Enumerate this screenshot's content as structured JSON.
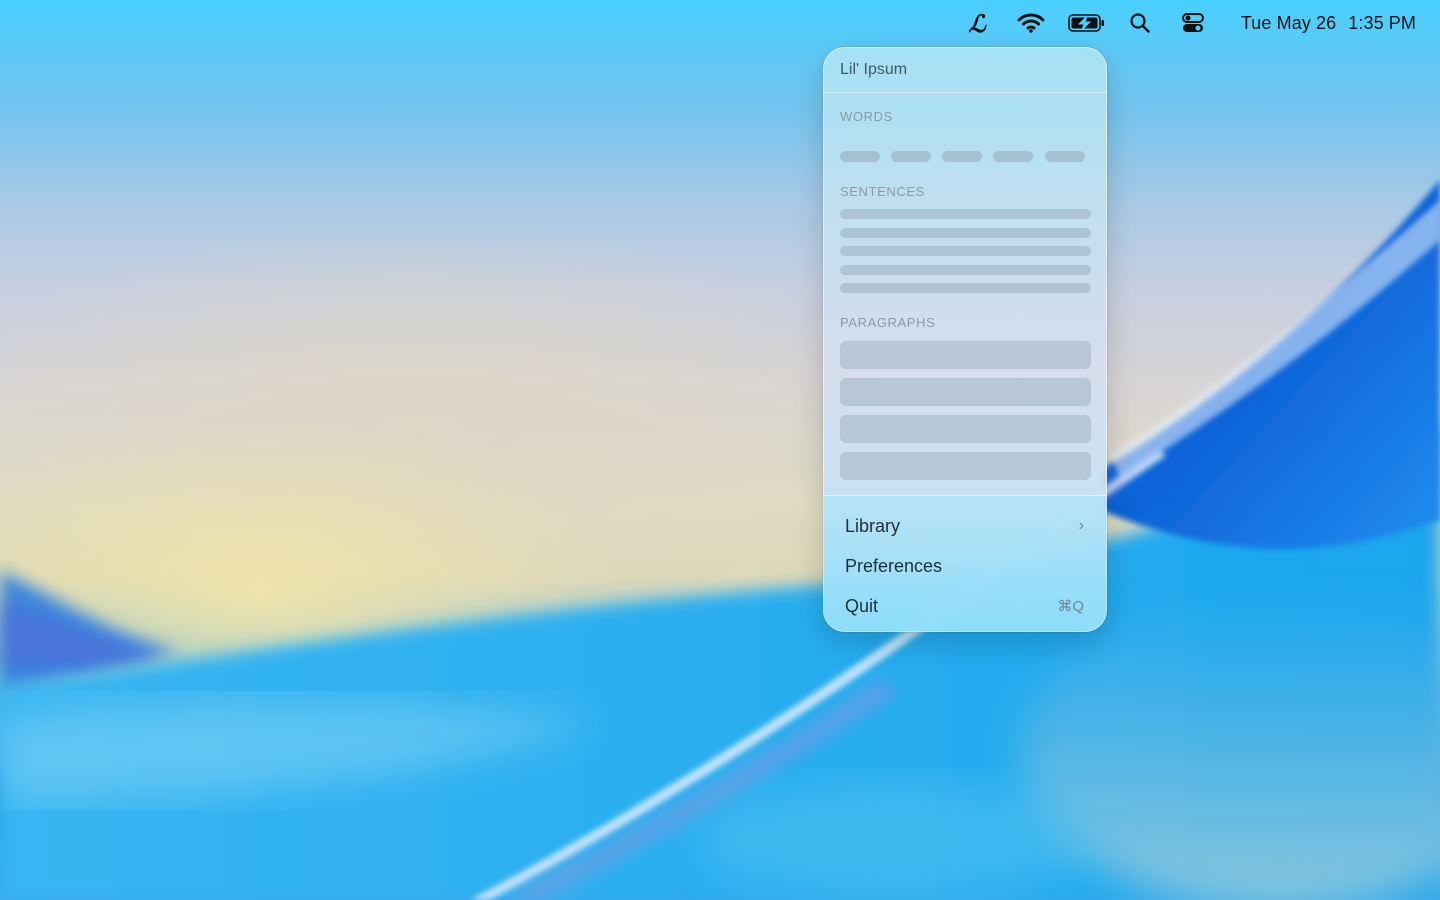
{
  "menubar": {
    "app_icon_glyph": "ℒ",
    "app_icon_name": "lil-ipsum-icon",
    "icons": [
      "wifi-icon",
      "battery-charging-icon",
      "search-icon",
      "control-center-icon"
    ],
    "date": "Tue May 26",
    "time": "1:35 PM"
  },
  "panel": {
    "title": "Lil' Ipsum",
    "sections": {
      "words": "WORDS",
      "sentences": "SENTENCES",
      "paragraphs": "PARAGRAPHS"
    },
    "menu": {
      "library": "Library",
      "library_chevron": "›",
      "preferences": "Preferences",
      "quit": "Quit",
      "quit_shortcut": "⌘Q"
    }
  },
  "colors": {
    "panel_bg": "#c4e0f0",
    "placeholder": "#96aab9",
    "menu_text": "#1e2f38"
  }
}
